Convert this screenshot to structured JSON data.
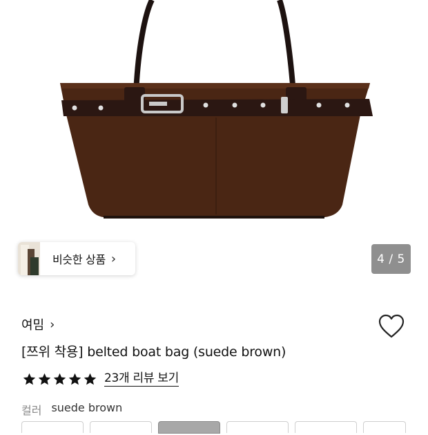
{
  "similar": {
    "label": "비슷한 상품",
    "chevron": "›"
  },
  "pager": {
    "text": "4 / 5"
  },
  "brand": {
    "name": "여밈",
    "chevron": "›"
  },
  "product": {
    "title": "[쯔위 착용] belted boat bag (suede brown)",
    "liked": false
  },
  "rating": {
    "stars": 5,
    "review_text": "23개 리뷰 보기"
  },
  "option": {
    "label": "컬러",
    "value": "suede brown",
    "selected_index": 2
  },
  "colors": {
    "suede": "#4a2614",
    "belt": "#2b1712",
    "star": "#111111",
    "pager_bg": "#8f8f8f"
  }
}
